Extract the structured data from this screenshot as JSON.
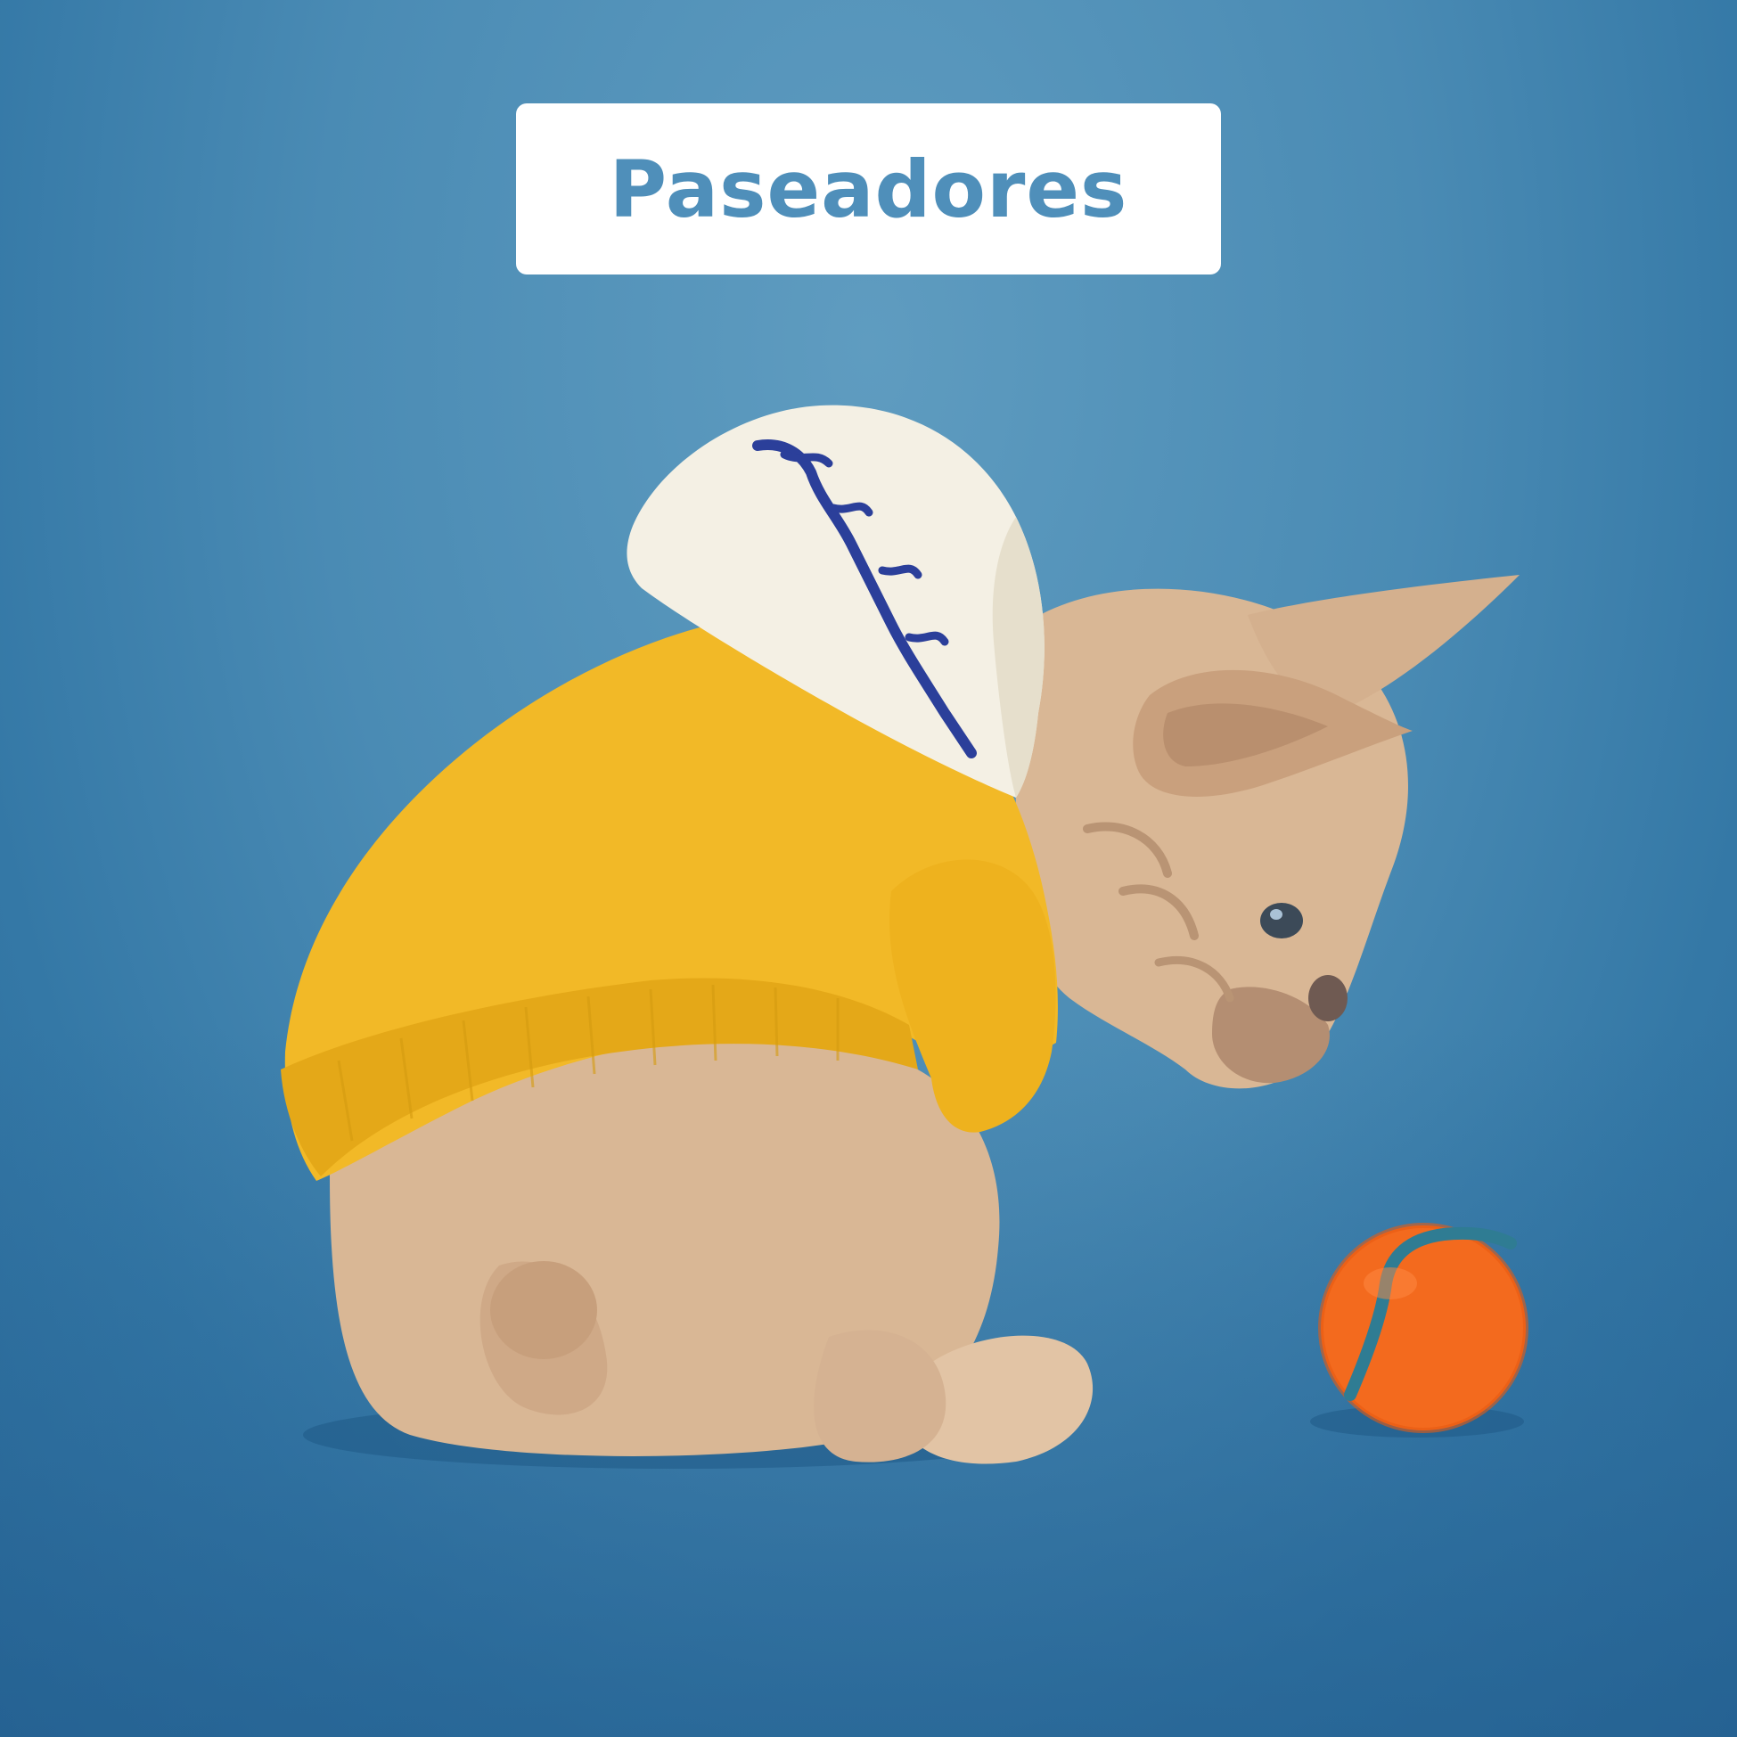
{
  "title": {
    "text": "Paseadores"
  },
  "colors": {
    "background": "#4a8bb4",
    "title_text": "#4f8fba",
    "card": "#ffffff",
    "hoodie": "#f2b927",
    "hood": "#f4f0e4",
    "dog_fur": "#d9b795",
    "ball": "#f36a1e",
    "ball_seam": "#2f7c93"
  },
  "illustration": {
    "subject": "dog-in-hoodie",
    "object": "tennis-ball"
  }
}
